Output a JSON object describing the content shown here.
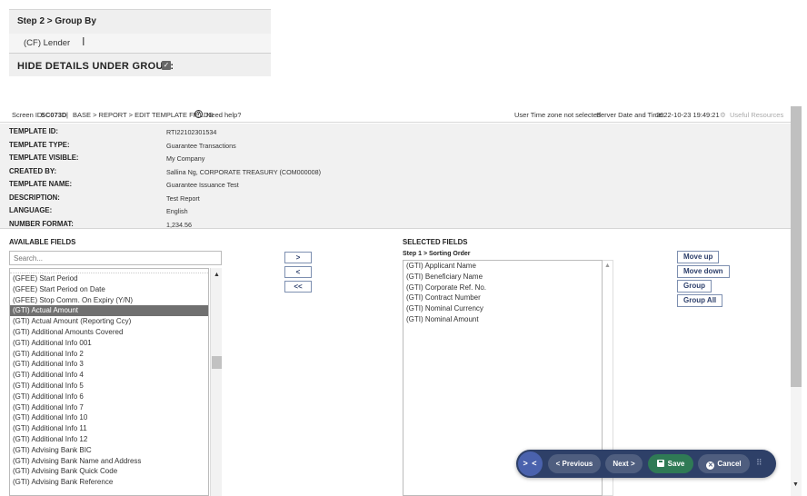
{
  "excerpt": {
    "step_title": "Step 2 > Group By",
    "lender_value": "(CF) Lender",
    "cursor_glyph": "I",
    "hide_details_label": "HIDE DETAILS UNDER GROUP:",
    "hide_details_checked": true,
    "checkmark": "✓"
  },
  "topbar": {
    "screen_id_label": "Screen ID:",
    "screen_id_value": "SC073D",
    "separator": "|",
    "breadcrumb": "BASE > REPORT > EDIT TEMPLATE FIELDS",
    "help_icon": "?",
    "help_label": "Need help?",
    "timezone_text": "User Time zone not selected",
    "server_time_label": "Server Date and Time:",
    "server_time_value": "2022-10-23 19:49:21",
    "useful_resources": "Useful Resources"
  },
  "template_info": [
    {
      "label": "TEMPLATE ID:",
      "value": "RTI22102301534"
    },
    {
      "label": "TEMPLATE TYPE:",
      "value": "Guarantee Transactions"
    },
    {
      "label": "TEMPLATE VISIBLE:",
      "value": "My Company"
    },
    {
      "label": "CREATED BY:",
      "value": "Sallina Ng, CORPORATE TREASURY (COM000008)"
    },
    {
      "label": "TEMPLATE NAME:",
      "value": "Guarantee Issuance Test"
    },
    {
      "label": "DESCRIPTION:",
      "value": "Test Report"
    },
    {
      "label": "LANGUAGE:",
      "value": "English"
    },
    {
      "label": "NUMBER FORMAT:",
      "value": "1,234.56"
    }
  ],
  "available": {
    "title": "AVAILABLE FIELDS",
    "search_placeholder": "Search...",
    "items": [
      {
        "label": "(GFEE) Start Period",
        "selected": false
      },
      {
        "label": "(GFEE) Start Period on Date",
        "selected": false
      },
      {
        "label": "(GFEE) Stop Comm. On Expiry (Y/N)",
        "selected": false
      },
      {
        "label": "(GTI) Actual Amount",
        "selected": true
      },
      {
        "label": "(GTI) Actual Amount (Reporting Ccy)",
        "selected": false
      },
      {
        "label": "(GTI) Additional Amounts Covered",
        "selected": false
      },
      {
        "label": "(GTI) Additional Info 001",
        "selected": false
      },
      {
        "label": "(GTI) Additional Info 2",
        "selected": false
      },
      {
        "label": "(GTI) Additional Info 3",
        "selected": false
      },
      {
        "label": "(GTI) Additional Info 4",
        "selected": false
      },
      {
        "label": "(GTI) Additional Info 5",
        "selected": false
      },
      {
        "label": "(GTI) Additional Info 6",
        "selected": false
      },
      {
        "label": "(GTI) Additional Info 7",
        "selected": false
      },
      {
        "label": "(GTI) Additional Info 10",
        "selected": false
      },
      {
        "label": "(GTI) Additional Info 11",
        "selected": false
      },
      {
        "label": "(GTI) Additional Info 12",
        "selected": false
      },
      {
        "label": "(GTI) Advising Bank BIC",
        "selected": false
      },
      {
        "label": "(GTI) Advising Bank Name and Address",
        "selected": false
      },
      {
        "label": "(GTI) Advising Bank Quick Code",
        "selected": false
      },
      {
        "label": "(GTI) Advising Bank Reference",
        "selected": false
      }
    ]
  },
  "transfer_buttons": {
    "add": ">",
    "remove": "<",
    "remove_all": "<<"
  },
  "selected": {
    "title": "SELECTED FIELDS",
    "step_label": "Step 1 > Sorting Order",
    "items": [
      "(GTI) Applicant Name",
      "(GTI) Beneficiary Name",
      "(GTI) Corporate Ref. No.",
      "(GTI) Contract Number",
      "(GTI) Nominal Currency",
      "(GTI) Nominal Amount"
    ]
  },
  "side_buttons": {
    "move_up": "Move up",
    "move_down": "Move down",
    "group": "Group",
    "group_all": "Group All"
  },
  "actionbar": {
    "toggle": "> <",
    "previous": "< Previous",
    "next": "Next >",
    "save": "Save",
    "cancel_icon": "✕",
    "cancel": "Cancel",
    "grip": "⠿"
  },
  "scroll_arrows": {
    "up": "▲",
    "down": "▼"
  },
  "colors": {
    "action_bar": "#2e4068",
    "save_green": "#2f7a55",
    "selected_row": "#707070",
    "info_bg": "#f1f1f1"
  }
}
